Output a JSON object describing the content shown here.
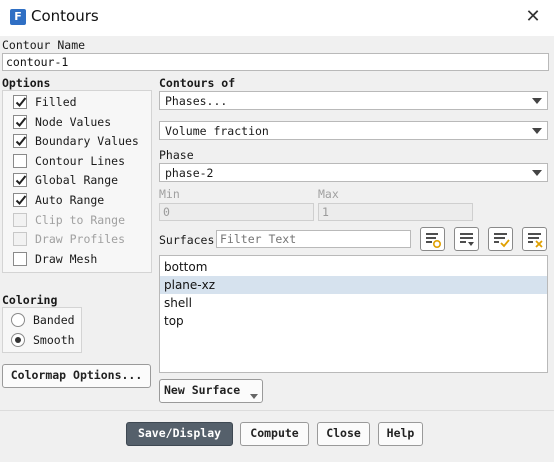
{
  "window": {
    "title": "Contours",
    "app_icon_letter": "F"
  },
  "contour_name": {
    "label": "Contour Name",
    "value": "contour-1"
  },
  "options": {
    "header": "Options",
    "items": [
      {
        "label": "Filled",
        "checked": true,
        "enabled": true
      },
      {
        "label": "Node Values",
        "checked": true,
        "enabled": true
      },
      {
        "label": "Boundary Values",
        "checked": true,
        "enabled": true
      },
      {
        "label": "Contour Lines",
        "checked": false,
        "enabled": true
      },
      {
        "label": "Global Range",
        "checked": true,
        "enabled": true
      },
      {
        "label": "Auto Range",
        "checked": true,
        "enabled": true
      },
      {
        "label": "Clip to Range",
        "checked": false,
        "enabled": false
      },
      {
        "label": "Draw Profiles",
        "checked": false,
        "enabled": false
      },
      {
        "label": "Draw Mesh",
        "checked": false,
        "enabled": true
      }
    ]
  },
  "coloring": {
    "header": "Coloring",
    "options": [
      {
        "label": "Banded",
        "selected": false
      },
      {
        "label": "Smooth",
        "selected": true
      }
    ]
  },
  "colormap_button": "Colormap Options...",
  "contours_of": {
    "label": "Contours of",
    "category": "Phases...",
    "variable": "Volume fraction"
  },
  "phase": {
    "label": "Phase",
    "value": "phase-2"
  },
  "range": {
    "min_label": "Min",
    "min_value": "0",
    "max_label": "Max",
    "max_value": "1"
  },
  "surfaces": {
    "label": "Surfaces",
    "filter_placeholder": "Filter Text",
    "items": [
      {
        "label": "bottom",
        "selected": false
      },
      {
        "label": "plane-xz",
        "selected": true
      },
      {
        "label": "shell",
        "selected": false
      },
      {
        "label": "top",
        "selected": false
      }
    ]
  },
  "new_surface_button": "New Surface",
  "actions": {
    "save_display": "Save/Display",
    "compute": "Compute",
    "close": "Close",
    "help": "Help"
  },
  "colors": {
    "primary_button": "#55606b",
    "selection": "#d6e2ee",
    "app_icon": "#2f6fc4",
    "icon_accent": "#e0a000"
  }
}
